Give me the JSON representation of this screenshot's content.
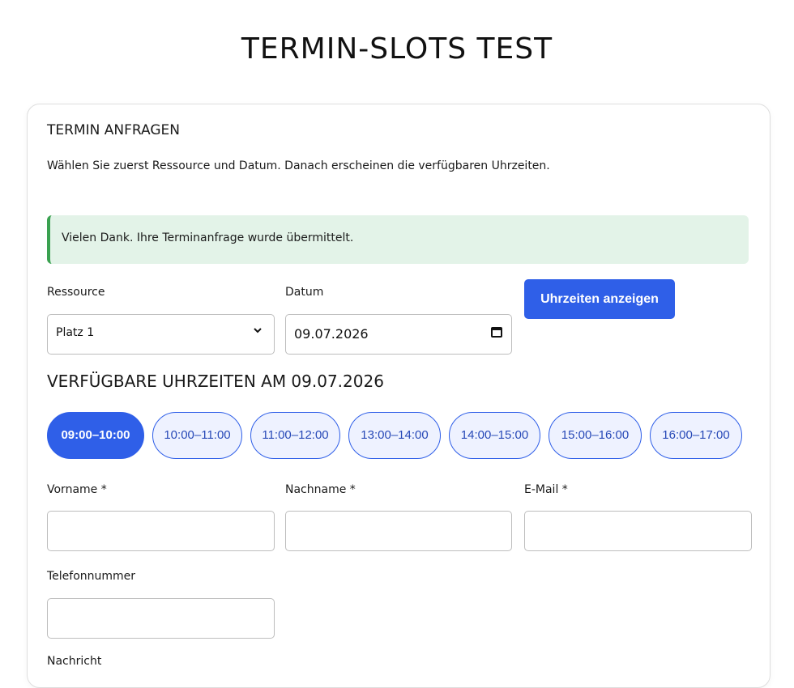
{
  "page": {
    "title": "TERMIN-SLOTS TEST"
  },
  "card": {
    "title": "TERMIN ANFRAGEN",
    "intro": "Wählen Sie zuerst Ressource und Datum. Danach erscheinen die verfügbaren Uhrzeiten.",
    "success_message": "Vielen Dank. Ihre Terminanfrage wurde übermittelt."
  },
  "filters": {
    "resource_label": "Ressource",
    "resource_value": "Platz 1",
    "date_label": "Datum",
    "date_value": "09.07.2026",
    "show_times_button": "Uhrzeiten anzeigen"
  },
  "slots": {
    "heading": "VERFÜGBARE UHRZEITEN AM 09.07.2026",
    "items": [
      {
        "label": "09:00–10:00",
        "selected": true
      },
      {
        "label": "10:00–11:00",
        "selected": false
      },
      {
        "label": "11:00–12:00",
        "selected": false
      },
      {
        "label": "13:00–14:00",
        "selected": false
      },
      {
        "label": "14:00–15:00",
        "selected": false
      },
      {
        "label": "15:00–16:00",
        "selected": false
      },
      {
        "label": "16:00–17:00",
        "selected": false
      }
    ]
  },
  "form": {
    "first_name_label": "Vorname *",
    "first_name_value": "",
    "last_name_label": "Nachname *",
    "last_name_value": "",
    "email_label": "E-Mail *",
    "email_value": "",
    "phone_label": "Telefonnummer",
    "phone_value": "",
    "message_label": "Nachricht"
  },
  "colors": {
    "primary": "#2f5fe8",
    "success_bg": "#e3f3e8",
    "success_border": "#3aa150"
  }
}
